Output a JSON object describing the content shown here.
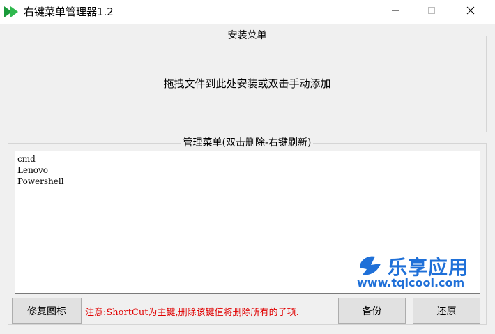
{
  "window": {
    "title": "右键菜单管理器1.2"
  },
  "install_group": {
    "legend": "安装菜单",
    "hint": "拖拽文件到此处安装或双击手动添加"
  },
  "manage_group": {
    "legend": "管理菜单(双击删除-右键刷新)",
    "items": [
      "cmd",
      "Lenovo",
      "Powershell"
    ]
  },
  "buttons": {
    "repair_label": "修复图标",
    "backup_label": "备份",
    "restore_label": "还原"
  },
  "warning_text": "注意:ShortCut为主键,删除该键值将删除所有的子项.",
  "watermark": {
    "brand": "乐享应用",
    "url": "www.tqlcool.com"
  },
  "colors": {
    "accent": "#1f70d8",
    "warning": "#e00000",
    "icon_green": "#1a9a3a"
  },
  "icons": {
    "app": "double-play-arrow-icon",
    "minimize": "minimize-icon",
    "maximize": "maximize-icon",
    "close": "close-icon"
  }
}
